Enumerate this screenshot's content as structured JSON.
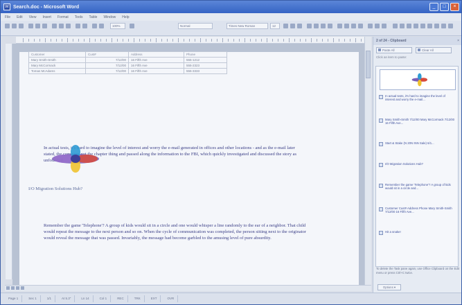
{
  "window": {
    "title": "Search.doc - Microsoft Word",
    "minimize": "_",
    "maximize": "□",
    "close": "×"
  },
  "menu": [
    "File",
    "Edit",
    "View",
    "Insert",
    "Format",
    "Tools",
    "Table",
    "Window",
    "Help"
  ],
  "toolbar": {
    "zoom": "100%",
    "style": "Normal",
    "font": "Times New Roman",
    "size": "12"
  },
  "document": {
    "table": {
      "headers": [
        "Customer",
        "Cust#",
        "Address",
        "Phone"
      ],
      "rows": [
        [
          "Mary Smith-Smith",
          "7/12/00",
          "16 Fifth Ave",
          "555-1212"
        ],
        [
          "Mary McCormack",
          "7/12/00",
          "16 Fifth Ave",
          "555-2323"
        ],
        [
          "Tomas McAdams",
          "7/12/00",
          "16 Fifth Ave",
          "555-3333"
        ]
      ]
    },
    "paragraph1": "In actual tests, it's hard to imagine the level of interest and worry the e-mail generated in offices and other locations - and as the e-mail later stated, the company got the chapter thing and passed along the information to the FBI, which quickly investigated and discussed the story as unfounded.",
    "heading": "I/O Migration Solutions Hub?",
    "paragraph2": "Remember the game 'Telephone'? A group of kids would sit in a circle and one would whisper a line randomly to the ear of a neighbor. That child would repeat the message to the next person and so on. When the cycle of communication was completed, the person sitting next to the originator would reveal the message that was passed. Invariably, the message had become garbled to the amusing level of pure absurdity."
  },
  "taskpane": {
    "title": "2 of 24 - Clipboard",
    "close": "×",
    "paste_all": "Paste All",
    "clear_all": "Clear All",
    "subtitle": "Click an item to paste:",
    "items": [
      "In actual tests, it's hard to imagine the level of interest and worry the e-mail...",
      "Mary Smith-Smith 7/12/00 Mary McCormack 7/12/00 16 Fifth Ave...",
      "Start & Stake (N 20N INN Sale) 6/1...",
      "I/O Migration Solutions Hub?",
      "Remember the game 'Telephone'? A group of kids would sit in a circle and...",
      "Customer Cust# Address Phone Mary Smith-Smith 7/12/00 16 Fifth Ave...",
      "Hit a snake!"
    ],
    "footer": "To delete the Task pane again, use Office Clipboard on the Edit menu or press Ctrl+C twice.",
    "options": "Options ▾"
  },
  "status": [
    "Page 1",
    "Sec 1",
    "1/1",
    "At 5.3\"",
    "Ln 14",
    "Col 1",
    "REC",
    "TRK",
    "EXT",
    "OVR"
  ]
}
